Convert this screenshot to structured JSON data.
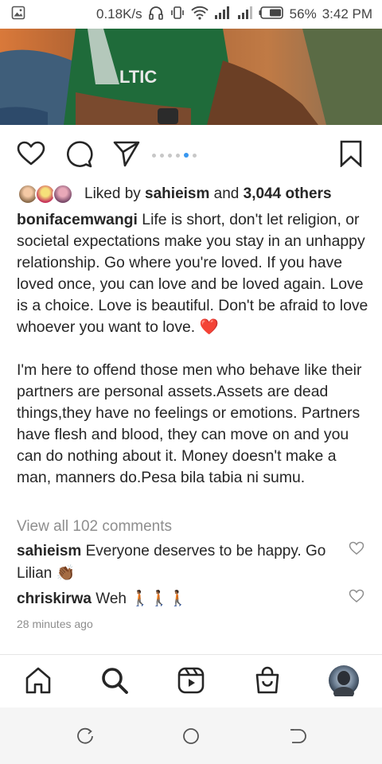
{
  "status_bar": {
    "speed": "0.18K/s",
    "battery": "56%",
    "time": "3:42 PM"
  },
  "post": {
    "carousel_pages": 6,
    "carousel_active_index": 4,
    "likes": {
      "prefix": "Liked by ",
      "user": "sahieism",
      "middle": " and ",
      "count": "3,044 others"
    },
    "caption": {
      "username": "bonifacemwangi",
      "paragraph1": " Life is short, don't let religion, or societal expectations make you stay in an unhappy relationship. Go where you're loved. If you have loved once, you can love and be loved again. Love is a choice. Love is beautiful. Don't be afraid to love whoever you want to love. ",
      "emoji1": "❤️",
      "paragraph2": "I'm here to offend those men who behave like their partners are personal assets.Assets are dead things,they have no feelings or emotions. Partners have flesh and blood, they can move on and you can do nothing about it. Money doesn't make a man, manners do.Pesa bila tabia ni sumu."
    },
    "view_all_comments": "View all 102 comments",
    "comments": [
      {
        "username": "sahieism",
        "text": " Everyone deserves to be happy. Go Lilian ",
        "emoji": "👏🏾"
      },
      {
        "username": "chriskirwa",
        "text": " Weh ",
        "emoji": "🚶🏾🚶🏾🚶🏾"
      }
    ],
    "timestamp": "28 minutes ago"
  },
  "icons": {
    "like": "heart-icon",
    "comment": "comment-icon",
    "share": "send-icon",
    "save": "bookmark-icon",
    "nav": [
      "home-icon",
      "search-icon",
      "reels-icon",
      "shop-icon",
      "profile-avatar"
    ]
  },
  "colors": {
    "accent": "#3897f0",
    "text": "#262626",
    "muted": "#8e8e8e",
    "heart_red": "#e0112b"
  }
}
